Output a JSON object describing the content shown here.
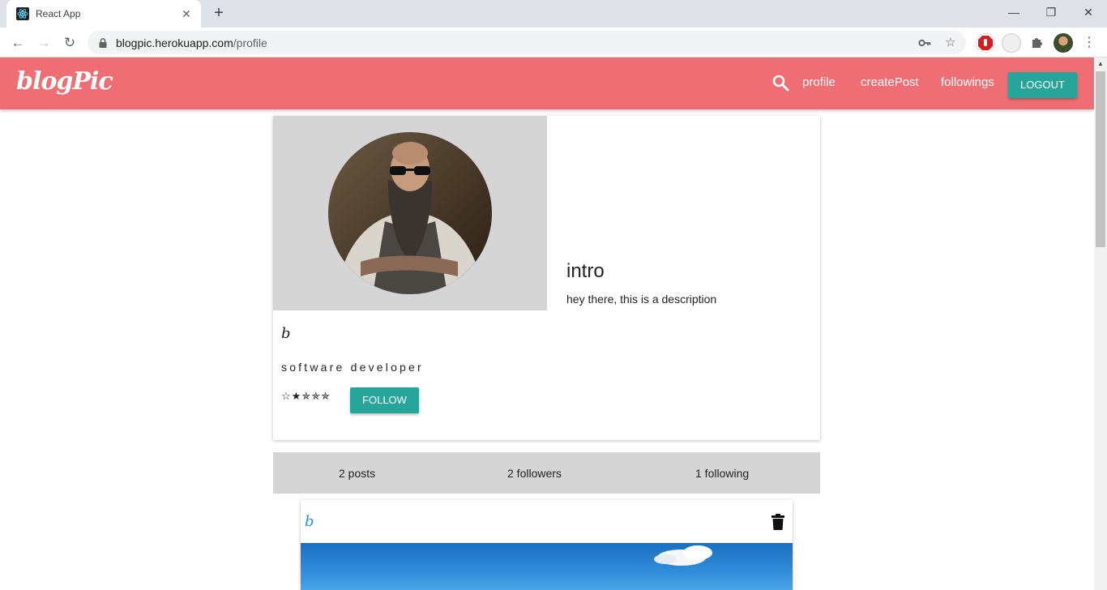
{
  "browser": {
    "tab_title": "React App",
    "tab_close": "✕",
    "new_tab": "+",
    "url_host": "blogpic.herokuapp.com",
    "url_path": "/profile",
    "window_controls": {
      "minimize": "—",
      "restore": "❐",
      "close": "✕"
    }
  },
  "nav": {
    "brand": "blogPic",
    "links": [
      "profile",
      "createPost",
      "followings"
    ],
    "logout_label": "LOGOUT"
  },
  "profile": {
    "intro_title": "intro",
    "intro_description": "hey there, this is a description",
    "mini_logo": "b",
    "occupation": "software developer",
    "stars": "☆★✯✯✯",
    "follow_label": "FOLLOW"
  },
  "stats": {
    "posts": "2 posts",
    "followers": "2 followers",
    "following": "1 following"
  },
  "post": {
    "logo": "b"
  },
  "colors": {
    "navbar": "#ef6e73",
    "button_teal": "#26a69a",
    "panel_gray": "#d5d5d5",
    "post_logo_blue": "#2196f3"
  },
  "icons": {
    "search": "search-icon",
    "trash": "trash-icon",
    "lock": "lock-icon",
    "key": "key-icon",
    "star": "bookmark-star-icon",
    "puzzle": "extensions-icon",
    "menu": "kebab-menu-icon"
  }
}
